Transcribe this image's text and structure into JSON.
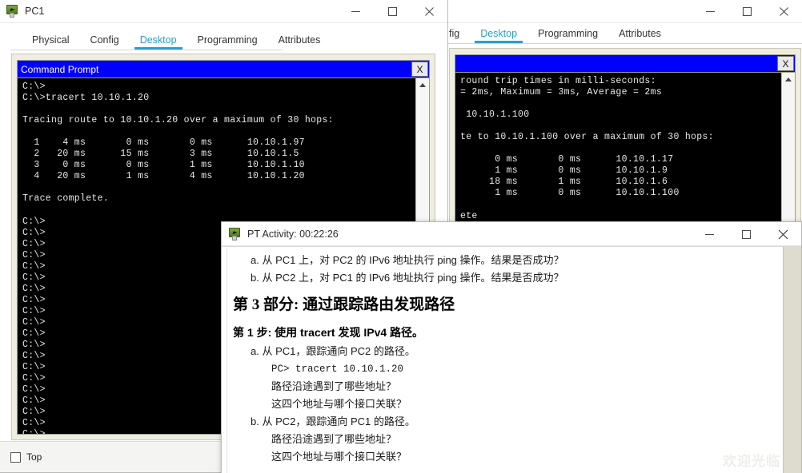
{
  "theme": {
    "cmd_title_bg": "#0000ff",
    "tab_active": "#2a9fd0",
    "panel_bg": "#eeeddf",
    "terminal_bg": "#000000",
    "terminal_fg": "#e8e8e8"
  },
  "pc1_window": {
    "title": "PC1",
    "icon": "packet-tracer-pc-icon",
    "minimize_label": "─",
    "maximize_label": "□",
    "close_label": "✕",
    "tabs": [
      {
        "label": "Physical",
        "active": false
      },
      {
        "label": "Config",
        "active": false
      },
      {
        "label": "Desktop",
        "active": true
      },
      {
        "label": "Programming",
        "active": false
      },
      {
        "label": "Attributes",
        "active": false
      }
    ],
    "command_prompt": {
      "title": "Command Prompt",
      "close_label": "X",
      "text": "C:\\>\nC:\\>tracert 10.10.1.20\n\nTracing route to 10.10.1.20 over a maximum of 30 hops:\n\n  1    4 ms       0 ms       0 ms      10.10.1.97\n  2   20 ms      15 ms       3 ms      10.10.1.5\n  3    0 ms       0 ms       1 ms      10.10.1.10\n  4   20 ms       1 ms       4 ms      10.10.1.20\n\nTrace complete.\n\nC:\\>\nC:\\>\nC:\\>\nC:\\>\nC:\\>\nC:\\>\nC:\\>\nC:\\>\nC:\\>\nC:\\>\nC:\\>\nC:\\>\nC:\\>\nC:\\>\nC:\\>\nC:\\>\nC:\\>\nC:\\>\nC:\\>\nC:\\>"
    },
    "footer": {
      "top_checkbox_label": "Top",
      "top_checkbox_checked": false
    }
  },
  "pc2_window": {
    "title": "",
    "minimize_label": "─",
    "maximize_label": "□",
    "close_label": "✕",
    "tabs": [
      {
        "label": "fig",
        "active": false
      },
      {
        "label": "Desktop",
        "active": true
      },
      {
        "label": "Programming",
        "active": false
      },
      {
        "label": "Attributes",
        "active": false
      }
    ],
    "command_prompt": {
      "title": "",
      "close_label": "X",
      "text": "round trip times in milli-seconds:\n= 2ms, Maximum = 3ms, Average = 2ms\n\n 10.10.1.100\n\nte to 10.10.1.100 over a maximum of 30 hops:\n\n      0 ms       0 ms      10.10.1.17\n      1 ms       0 ms      10.10.1.9\n     18 ms       1 ms      10.10.1.6\n      1 ms       0 ms      10.10.1.100\n\nete"
    }
  },
  "pt_activity_dialog": {
    "title": "PT Activity: 00:22:26",
    "icon": "packet-tracer-activity-icon",
    "minimize_label": "─",
    "maximize_label": "□",
    "close_label": "✕",
    "content": {
      "prev_items": [
        "a. 从 PC1 上，对 PC2 的 IPv6 地址执行 ping 操作。结果是否成功？",
        "b. 从 PC2 上，对 PC1 的 IPv6 地址执行 ping 操作。结果是否成功？"
      ],
      "part_heading": "第 3 部分: 通过跟踪路由发现路径",
      "step_heading": "第 1 步: 使用 tracert 发现 IPv4 路径。",
      "items": [
        {
          "label": "a. 从 PC1，跟踪通向 PC2 的路径。",
          "code": "PC> tracert 10.10.1.20",
          "questions": [
            "路径沿途遇到了哪些地址？",
            "这四个地址与哪个接口关联？"
          ]
        },
        {
          "label": "b. 从 PC2，跟踪通向 PC1 的路径。",
          "code": "",
          "questions": [
            "路径沿途遇到了哪些地址？",
            "这四个地址与哪个接口关联？"
          ]
        }
      ],
      "watermark": "欢迎光临"
    }
  }
}
